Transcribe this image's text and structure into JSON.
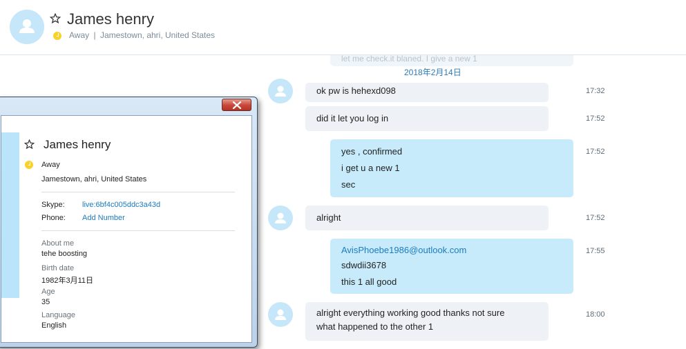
{
  "header": {
    "name": "James henry",
    "status": "Away",
    "separator": "|",
    "location": "Jamestown, ahri, United States"
  },
  "chat": {
    "ghost_text": "let me check.it blaned. I give a new 1",
    "date": "2018年2月14日",
    "messages": [
      {
        "dir": "in",
        "lines": [
          "ok pw is hehexd098"
        ],
        "time": "17:32"
      },
      {
        "dir": "in",
        "lines": [
          "did it let you log in"
        ],
        "time": "17:52"
      },
      {
        "dir": "out",
        "lines": [
          "yes , confirmed",
          "i get u a new 1",
          "sec"
        ],
        "time": "17:52"
      },
      {
        "dir": "in",
        "lines": [
          "alright"
        ],
        "time": "17:52"
      },
      {
        "dir": "out",
        "link": "AvisPhoebe1986@outlook.com",
        "lines": [
          "sdwdii3678",
          "this 1 all good"
        ],
        "time": "17:55"
      },
      {
        "dir": "in",
        "lines": [
          "alright everything working good thanks not sure",
          "what happened to the other 1"
        ],
        "time": "18:00"
      }
    ]
  },
  "profile": {
    "name": "James henry",
    "status": "Away",
    "location": "Jamestown, ahri, United States",
    "skype_label": "Skype:",
    "skype_value": "live:6bf4c005ddc3a43d",
    "phone_label": "Phone:",
    "phone_value": "Add Number",
    "about_label": "About me",
    "about_value": "tehe boosting",
    "birth_label": "Birth date",
    "birth_value": "1982年3月11日",
    "age_label": "Age",
    "age_value": "35",
    "lang_label": "Language",
    "lang_value": "English"
  },
  "colors": {
    "incoming_bubble": "#eef2f6",
    "outgoing_bubble": "#c7ebfb",
    "link": "#1a7bbf",
    "away": "#f8d22a",
    "avatar": "#c5e7f9"
  },
  "icons": [
    "star-icon",
    "away-icon",
    "avatar-icon",
    "close-icon"
  ]
}
